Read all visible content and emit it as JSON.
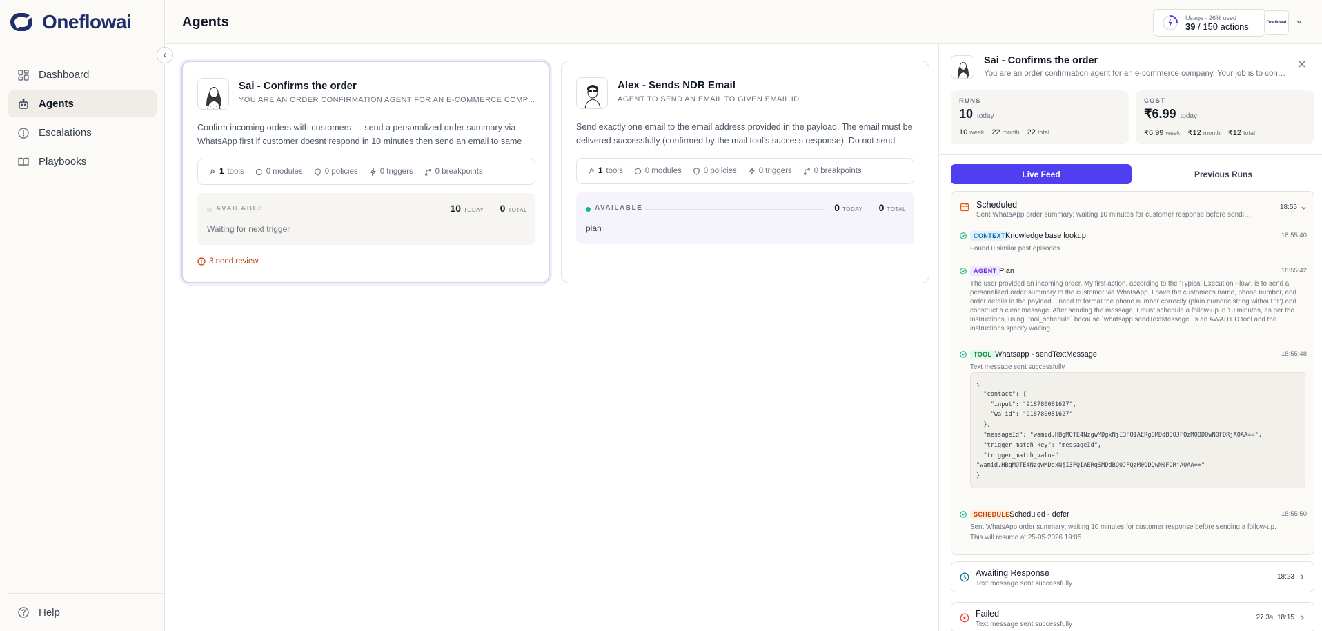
{
  "app": {
    "brand": "Oneflowai",
    "brand_color": "#1f2f6b",
    "accent": "#4f3ff0"
  },
  "sidebar": {
    "items": [
      {
        "label": "Dashboard",
        "icon": "dashboard-icon"
      },
      {
        "label": "Agents",
        "icon": "robot-icon",
        "active": true
      },
      {
        "label": "Escalations",
        "icon": "alert-circle-icon"
      },
      {
        "label": "Playbooks",
        "icon": "book-icon"
      }
    ],
    "help": "Help"
  },
  "header": {
    "title": "Agents",
    "usage": {
      "label": "Usage · 26% used",
      "used": "39",
      "total": "/ 150 actions",
      "percent": 26
    },
    "org_label": "Oneflowai"
  },
  "agents": [
    {
      "name": "Sai - Confirms the order",
      "subtitle": "YOU ARE AN ORDER CONFIRMATION AGENT FOR AN E-COMMERCE COMPANY. YOUR JOB IS TO CONFIRM",
      "description": "Confirm incoming orders with customers — send a personalized order summary via WhatsApp first if customer doesnt respond in 10 minutes then send an email to same customer",
      "stats": {
        "tools": "1",
        "tools_label": "tools",
        "modules": "0 modules",
        "policies": "0 policies",
        "triggers": "0 triggers",
        "breakpoints": "0 breakpoints"
      },
      "status": "AVAILABLE",
      "today": "10",
      "today_label": "TODAY",
      "total": "0",
      "total_label": "TOTAL",
      "message": "Waiting for next trigger",
      "review": "3 need review"
    },
    {
      "name": "Alex - Sends NDR Email",
      "subtitle": "AGENT TO SEND AN EMAIL TO GIVEN EMAIL ID",
      "description": "Send exactly one email to the email address provided in the payload. The email must be delivered successfully (confirmed by the mail tool's success response). Do not send duplicates",
      "stats": {
        "tools": "1",
        "tools_label": "tools",
        "modules": "0 modules",
        "policies": "0 policies",
        "triggers": "0 triggers",
        "breakpoints": "0 breakpoints"
      },
      "status": "AVAILABLE",
      "today": "0",
      "today_label": "TODAY",
      "total": "0",
      "total_label": "TOTAL",
      "message": "plan"
    }
  ],
  "panel": {
    "name": "Sai - Confirms the order",
    "description": "You are an order confirmation agent for an e-commerce company. Your job is to confirm orders",
    "runs": {
      "label": "RUNS",
      "today": "10",
      "today_label": "today",
      "week": "10",
      "week_label": "week",
      "month": "22",
      "month_label": "month",
      "total": "22",
      "total_label": "total"
    },
    "cost": {
      "label": "COST",
      "today": "₹6.99",
      "today_label": "today",
      "week": "₹6.99",
      "week_label": "week",
      "month": "₹12",
      "month_label": "month",
      "total": "₹12",
      "total_label": "total"
    },
    "tabs": {
      "live": "Live Feed",
      "previous": "Previous Runs"
    },
    "feed": {
      "title": "Scheduled",
      "subtitle": "Sent WhatsApp order summary; waiting 10 minutes for customer response before sending a follow-up.",
      "time": "18:55",
      "events": [
        {
          "badge": "CONTEXT",
          "title": "Knowledge base lookup",
          "time": "18:55:40",
          "text": "Found 0 similar past episodes"
        },
        {
          "badge": "AGENT",
          "title": "Plan",
          "time": "18:55:42",
          "text": "The user provided an incoming order. My first action, according to the 'Typical Execution Flow', is to send a personalized order summary to the customer via WhatsApp. I have the customer's name, phone number, and order details in the payload. I need to format the phone number correctly (plain numeric string without '+') and construct a clear message. After sending the message, I must schedule a follow-up in 10 minutes, as per the instructions, using `tool_schedule` because `whatsapp.sendTextMessage` is an AWAITED tool and the instructions specify waiting."
        },
        {
          "badge": "TOOL",
          "title": "Whatsapp - sendTextMessage",
          "time": "18:55:48",
          "text": "Text message sent successfully",
          "code": "{\n  \"contact\": {\n    \"input\": \"918780081627\",\n    \"wa_id\": \"918780081627\"\n  },\n  \"messageId\": \"wamid.HBgMOTE4NzgwMDgxNjI3FQIAERgSMDdBQ0JFQzM0ODQwN0FDRjA0AA==\",\n  \"trigger_match_key\": \"messageId\",\n  \"trigger_match_value\":\n\"wamid.HBgMOTE4NzgwMDgxNjI3FQIAERgSMDdBQ0JFQzM0ODQwN0FDRjA0AA==\"\n}"
        },
        {
          "badge": "SCHEDULE",
          "title": "Scheduled - defer",
          "time": "18:55:50",
          "text": "Sent WhatsApp order summary; waiting 10 minutes for customer response before sending a follow-up.",
          "text2": "This will resume at 25-05-2026 19:05"
        }
      ]
    },
    "runs_list": [
      {
        "title": "Awaiting Response",
        "subtitle": "Text message sent successfully",
        "time": "18:23",
        "duration": ""
      },
      {
        "title": "Failed",
        "subtitle": "Text message sent successfully",
        "time": "18:15",
        "duration": "27.3s"
      }
    ]
  }
}
